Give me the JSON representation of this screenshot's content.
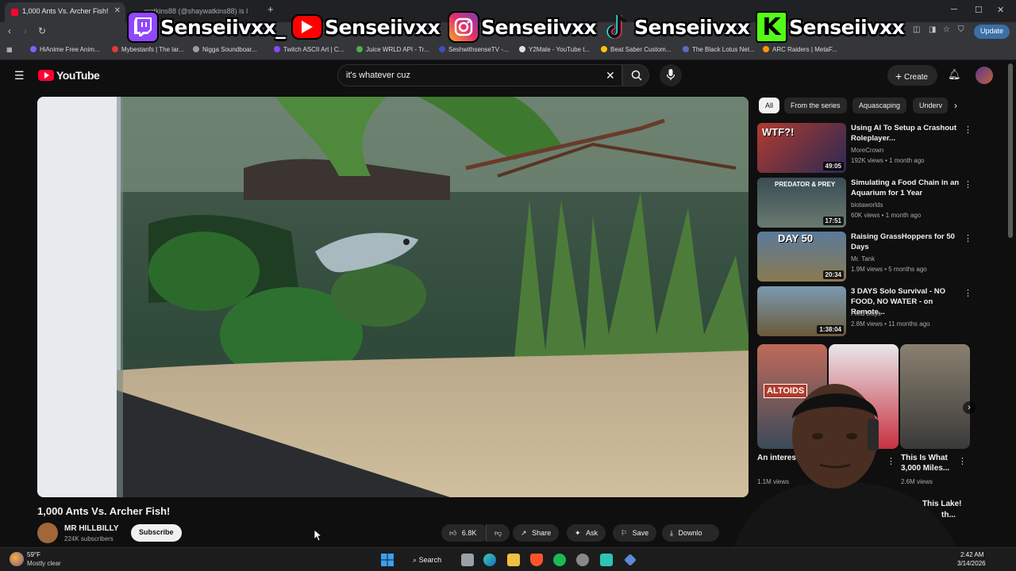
{
  "browser": {
    "tabs": [
      {
        "label": "1,000 Ants Vs. Archer Fish!"
      },
      {
        "label": "watkins88 (@shaywatkins88) is l"
      }
    ],
    "window_controls": {
      "minimize": "─",
      "maximize": "☐",
      "close": "✕"
    },
    "new_tab": "+",
    "update_label": "Update",
    "bookmarks": [
      {
        "label": "HiAnime Free Anim...",
        "color": "#7b61ff"
      },
      {
        "label": "Mybestanfs | The lar...",
        "color": "#e53935"
      },
      {
        "label": "Nigga Soundboar...",
        "color": "#9e9e9e"
      },
      {
        "label": "Twitch ASCII Art | C...",
        "color": "#9146ff"
      },
      {
        "label": "Juice WRLD API - Tr...",
        "color": "#4caf50"
      },
      {
        "label": "SeshwithsenseTV -...",
        "color": "#3f51b5"
      },
      {
        "label": "Y2Mate - YouTube t...",
        "color": "#e0e0e0"
      },
      {
        "label": "Beat Saber Custom...",
        "color": "#ffc107"
      },
      {
        "label": "The Black Lotus Net...",
        "color": "#5c6bc0"
      },
      {
        "label": "ARC Raiders | MetaF...",
        "color": "#ff9800"
      }
    ]
  },
  "overlay": {
    "socials": [
      {
        "platform": "twitch-icon",
        "handle": "Senseiivxx_",
        "color": "#9146ff"
      },
      {
        "platform": "youtube-icon",
        "handle": "Senseiivxx",
        "color": "#ff0000"
      },
      {
        "platform": "instagram-icon",
        "handle": "Senseiivxx",
        "color": "#e1306c"
      },
      {
        "platform": "tiktok-icon",
        "handle": "Senseiivxx",
        "color": "#111111"
      },
      {
        "platform": "kick-icon",
        "handle": "Senseiivxx",
        "color": "#53fc18"
      }
    ]
  },
  "youtube": {
    "logo_text": "YouTube",
    "search_query": "it's whatever cuz",
    "create_label": "Create",
    "video": {
      "title": "1,000 Ants Vs. Archer Fish!",
      "channel": "MR HILLBILLY",
      "subscribers": "224K subscribers",
      "subscribe_label": "Subscribe",
      "likes": "6.8K",
      "share_label": "Share",
      "ask_label": "Ask",
      "save_label": "Save",
      "download_label": "Downlo"
    },
    "chips": [
      "All",
      "From the series",
      "Aquascaping",
      "Underv"
    ],
    "suggestions": [
      {
        "title": "Using AI To Setup a Crashout Roleplayer...",
        "channel": "MoreCrown",
        "meta": "192K views • 1 month ago",
        "duration": "49:05",
        "thumb_text": "WTF?!"
      },
      {
        "title": "Simulating a Food Chain in an Aquarium for 1 Year",
        "channel": "biotaworlds",
        "meta": "60K views • 1 month ago",
        "duration": "17:51",
        "thumb_text": "PREDATOR & PREY"
      },
      {
        "title": "Raising GrassHoppers for 50 Days",
        "channel": "Mr. Tank",
        "meta": "1.9M views • 5 months ago",
        "duration": "20:34",
        "thumb_text": "DAY 50"
      },
      {
        "title": "3 DAYS Solo Survival - NO FOOD, NO WATER - on Remote...",
        "channel": "Field Days",
        "meta": "2.8M views • 11 months ago",
        "duration": "1:38:04",
        "thumb_text": ""
      }
    ],
    "shorts": [
      {
        "title": "An interesting...",
        "views": "1.1M views",
        "thumb_text": "ALTOIDS"
      },
      {
        "title": "This Is What 3,000 Miles...",
        "views": "2.6M views",
        "thumb_text": ""
      }
    ],
    "partial_short_title": "This Lake!",
    "partial_short_sub": "th..."
  },
  "taskbar": {
    "weather_temp": "59°F",
    "weather_desc": "Mostly clear",
    "search_label": "Search",
    "time": "2:42 AM",
    "date": "3/14/2026"
  }
}
